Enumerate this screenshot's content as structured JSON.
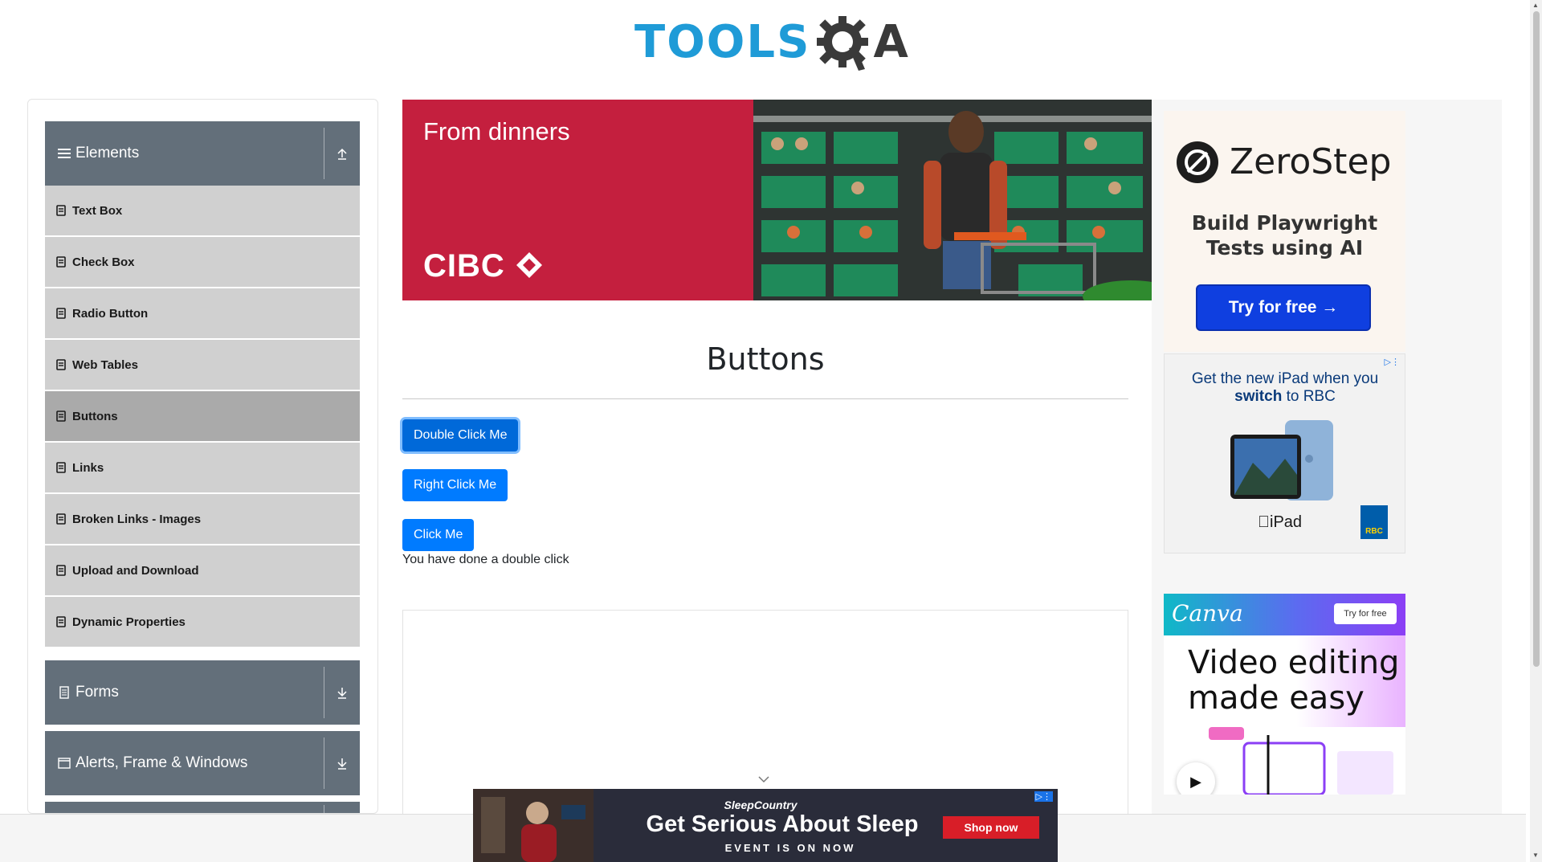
{
  "header": {
    "logo_text": "TOOLS",
    "logo_suffix": "A"
  },
  "sidebar": {
    "groups": [
      {
        "label": "Elements",
        "icon": "list-icon",
        "arrow": "expand-up-icon"
      },
      {
        "label": "Forms",
        "icon": "document-icon",
        "arrow": "download-icon"
      },
      {
        "label": "Alerts, Frame & Windows",
        "icon": "window-icon",
        "arrow": "download-icon"
      }
    ],
    "items": [
      {
        "label": "Text Box"
      },
      {
        "label": "Check Box"
      },
      {
        "label": "Radio Button"
      },
      {
        "label": "Web Tables"
      },
      {
        "label": "Buttons"
      },
      {
        "label": "Links"
      },
      {
        "label": "Broken Links - Images"
      },
      {
        "label": "Upload and Download"
      },
      {
        "label": "Dynamic Properties"
      }
    ],
    "active_item": "Buttons"
  },
  "banner_ad": {
    "headline": "From dinners",
    "brand": "CIBC",
    "brand_color": "#c41f3e"
  },
  "main": {
    "title": "Buttons",
    "buttons": {
      "double_click": "Double Click Me",
      "right_click": "Right Click Me",
      "click": "Click Me"
    },
    "result_message": "You have done a double click"
  },
  "ads": {
    "zerostep": {
      "name": "ZeroStep",
      "tagline": "Build Playwright Tests using AI",
      "cta": "Try for free →"
    },
    "rbc": {
      "headline_prefix": "Get the new iPad when you ",
      "headline_bold": "switch",
      "headline_suffix": " to RBC",
      "product": "iPad",
      "badge": "RBC"
    },
    "canva": {
      "brand": "Canva",
      "cta": "Try for free",
      "headline": "Video editing made easy"
    },
    "sleep": {
      "brand": "SleepCountry",
      "headline": "Get Serious About Sleep",
      "subline": "EVENT IS ON NOW",
      "cta": "Shop now"
    }
  },
  "colors": {
    "primary_button": "#007bff",
    "sidebar_header": "#636f7a",
    "menu_item": "#d0d0d0",
    "logo_blue": "#1f9bd7"
  }
}
